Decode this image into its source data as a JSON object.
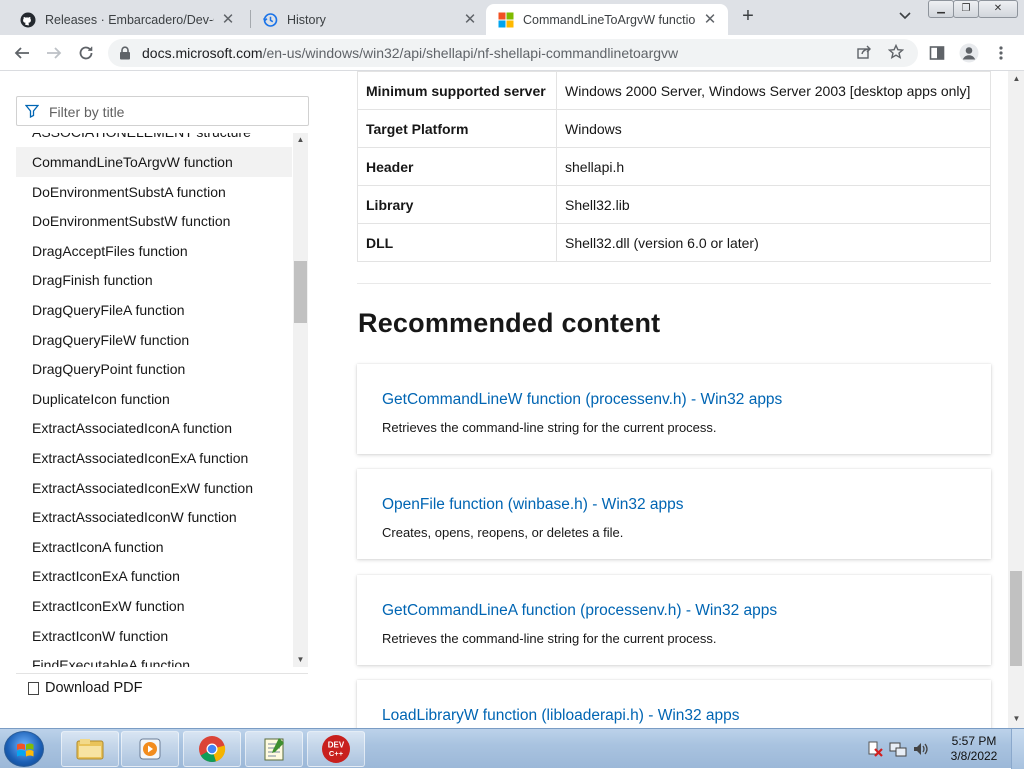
{
  "tabs": [
    {
      "title": "Releases · Embarcadero/Dev-Cpp",
      "icon": "github-icon",
      "close": "✕"
    },
    {
      "title": "History",
      "icon": "history-icon",
      "close": "✕"
    },
    {
      "title": "CommandLineToArgvW function",
      "icon": "microsoft-icon",
      "close": "✕",
      "active": true
    }
  ],
  "new_tab": "+",
  "address": {
    "host": "docs.microsoft.com",
    "path": "/en-us/windows/win32/api/shellapi/nf-shellapi-commandlinetoargvw"
  },
  "sidebar": {
    "filter_placeholder": "Filter by title",
    "items": [
      "ASSOCIATIONELEMENT structure",
      "CommandLineToArgvW function",
      "DoEnvironmentSubstA function",
      "DoEnvironmentSubstW function",
      "DragAcceptFiles function",
      "DragFinish function",
      "DragQueryFileA function",
      "DragQueryFileW function",
      "DragQueryPoint function",
      "DuplicateIcon function",
      "ExtractAssociatedIconA function",
      "ExtractAssociatedIconExA function",
      "ExtractAssociatedIconExW function",
      "ExtractAssociatedIconW function",
      "ExtractIconA function",
      "ExtractIconExA function",
      "ExtractIconExW function",
      "ExtractIconW function",
      "FindExecutableA function"
    ],
    "selected_index": 1,
    "download_pdf": "Download PDF"
  },
  "requirements": [
    {
      "key": "Minimum supported server",
      "value": "Windows 2000 Server, Windows Server 2003 [desktop apps only]"
    },
    {
      "key": "Target Platform",
      "value": "Windows"
    },
    {
      "key": "Header",
      "value": "shellapi.h"
    },
    {
      "key": "Library",
      "value": "Shell32.lib"
    },
    {
      "key": "DLL",
      "value": "Shell32.dll (version 6.0 or later)"
    }
  ],
  "recommended": {
    "heading": "Recommended content",
    "cards": [
      {
        "title": "GetCommandLineW function (processenv.h) - Win32 apps",
        "desc": "Retrieves the command-line string for the current process."
      },
      {
        "title": "OpenFile function (winbase.h) - Win32 apps",
        "desc": "Creates, opens, reopens, or deletes a file."
      },
      {
        "title": "GetCommandLineA function (processenv.h) - Win32 apps",
        "desc": "Retrieves the command-line string for the current process."
      },
      {
        "title": "LoadLibraryW function (libloaderapi.h) - Win32 apps",
        "desc": ""
      }
    ]
  },
  "taskbar": {
    "apps": [
      "explorer-icon",
      "media-player-icon",
      "chrome-icon",
      "notepad-icon",
      "devcpp-icon"
    ],
    "devcpp_label": "DEV C++",
    "time": "5:57 PM",
    "date": "3/8/2022"
  },
  "colors": {
    "link": "#0065b3",
    "accent": "#0078d4"
  }
}
